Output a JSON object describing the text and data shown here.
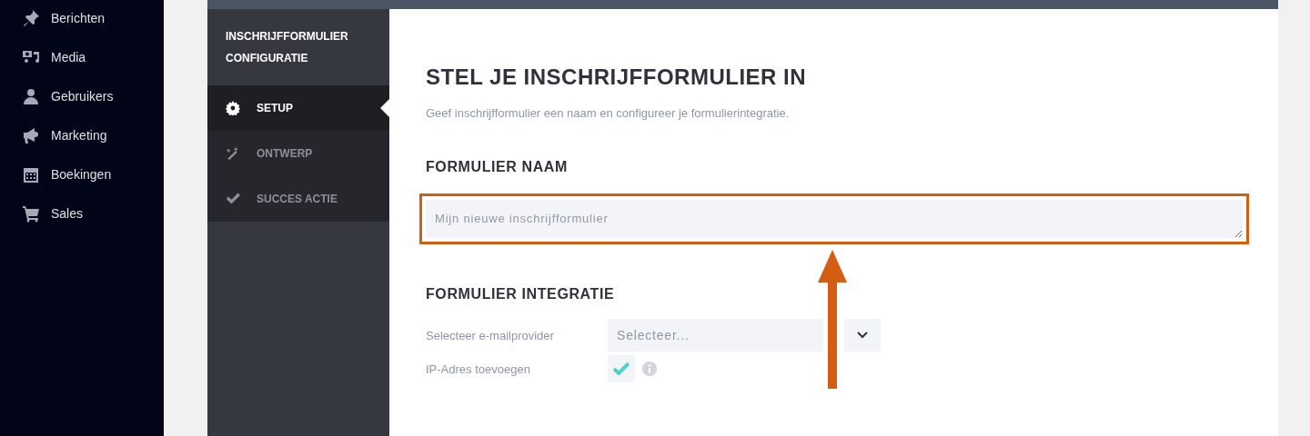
{
  "sidebar": {
    "items": [
      {
        "label": "Berichten",
        "kind": "pin"
      },
      {
        "label": "Media",
        "kind": "media"
      },
      {
        "label": "Gebruikers",
        "kind": "user"
      },
      {
        "label": "Marketing",
        "kind": "megaphone"
      },
      {
        "label": "Boekingen",
        "kind": "calendar"
      },
      {
        "label": "Sales",
        "kind": "cart"
      }
    ]
  },
  "config_nav": {
    "title_lines": [
      "INSCHRIJFFORMULIER",
      "CONFIGURATIE"
    ],
    "items": [
      {
        "label": "SETUP",
        "kind": "gear",
        "selected": true
      },
      {
        "label": "ONTWERP",
        "kind": "wand",
        "selected": false
      },
      {
        "label": "SUCCES ACTIE",
        "kind": "check",
        "selected": false
      }
    ]
  },
  "content": {
    "title": "STEL JE INSCHRIJFFORMULIER IN",
    "subtitle": "Geef inschrijfformulier een naam en configureer je formulierintegratie.",
    "name_section": {
      "heading": "FORMULIER NAAM",
      "placeholder": "Mijn nieuwe inschrijfformulier",
      "highlighted": true
    },
    "integration_section": {
      "heading": "FORMULIER INTEGRATIE",
      "provider": {
        "label": "Selecteer e-mailprovider",
        "placeholder": "Selecteer..."
      },
      "ip_address": {
        "label": "IP-Adres toevoegen",
        "checked": true
      }
    }
  }
}
